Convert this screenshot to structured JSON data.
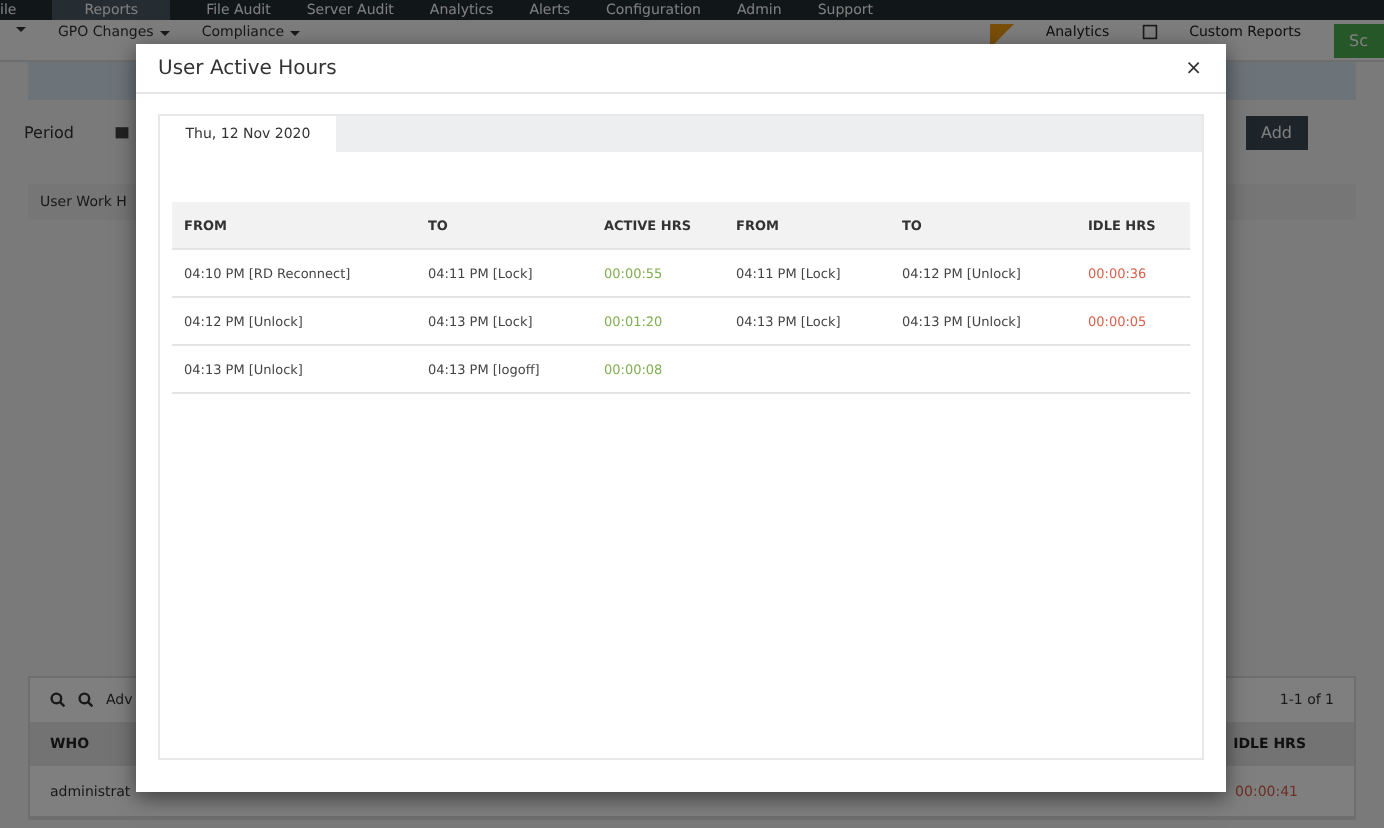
{
  "nav": {
    "items": [
      {
        "label": "ile",
        "selected": false
      },
      {
        "label": "Reports",
        "selected": true
      },
      {
        "label": "File Audit",
        "selected": false
      },
      {
        "label": "Server Audit",
        "selected": false
      },
      {
        "label": "Analytics",
        "selected": false
      },
      {
        "label": "Alerts",
        "selected": false
      },
      {
        "label": "Configuration",
        "selected": false
      },
      {
        "label": "Admin",
        "selected": false
      },
      {
        "label": "Support",
        "selected": false
      }
    ]
  },
  "subnav": {
    "menus": [
      "GPO Changes",
      "Compliance"
    ],
    "analytics": "Analytics",
    "custom_reports": "Custom Reports",
    "schedule_button": "Sc"
  },
  "period": {
    "label": "Period",
    "add_button": "Add"
  },
  "report_tab": "User Work H",
  "grid": {
    "advanced": "Adv",
    "pager": "1-1 of 1",
    "columns": [
      "WHO",
      "IDLE HRS"
    ],
    "rows": [
      {
        "who": "administrat",
        "idle": "00:00:41"
      }
    ]
  },
  "modal": {
    "title": "User Active Hours",
    "close": "×",
    "tabs": [
      {
        "label": "Thu, 12 Nov 2020",
        "selected": true
      }
    ],
    "columns": [
      {
        "label": "FROM",
        "kind": "time"
      },
      {
        "label": "TO",
        "kind": "time"
      },
      {
        "label": "ACTIVE HRS",
        "kind": "active"
      },
      {
        "label": "FROM",
        "kind": "time"
      },
      {
        "label": "TO",
        "kind": "time"
      },
      {
        "label": "IDLE HRS",
        "kind": "idle"
      }
    ],
    "rows": [
      {
        "cells": [
          "04:10 PM [RD Reconnect]",
          "04:11 PM [Lock]",
          "00:00:55",
          "04:11 PM [Lock]",
          "04:12 PM [Unlock]",
          "00:00:36"
        ]
      },
      {
        "cells": [
          "04:12 PM [Unlock]",
          "04:13 PM [Lock]",
          "00:01:20",
          "04:13 PM [Lock]",
          "04:13 PM [Unlock]",
          "00:00:05"
        ]
      },
      {
        "cells": [
          "04:13 PM [Unlock]",
          "04:13 PM [logoff]",
          "00:00:08"
        ]
      }
    ]
  }
}
